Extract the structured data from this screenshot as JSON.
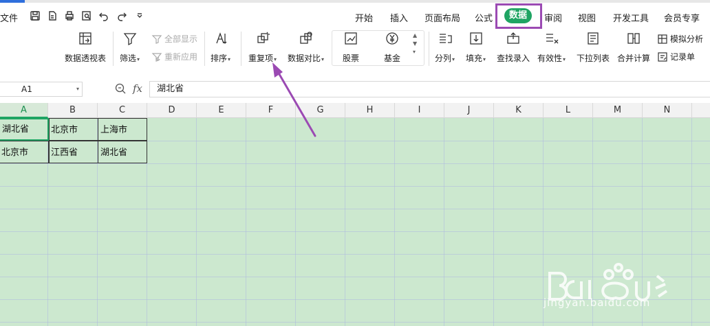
{
  "menu": {
    "file": "文件",
    "tabs": [
      "开始",
      "插入",
      "页面布局",
      "公式",
      "审阅",
      "视图",
      "开发工具",
      "会员专享"
    ],
    "active_tab": "数据"
  },
  "ribbon": {
    "pivot": "数据透视表",
    "filter": "筛选",
    "show_all": "全部显示",
    "reapply": "重新应用",
    "sort": "排序",
    "duplicates": "重复项",
    "compare": "数据对比",
    "stock": "股票",
    "fund": "基金",
    "split": "分列",
    "fill": "填充",
    "lookup": "查找录入",
    "validity": "有效性",
    "dropdown": "下拉列表",
    "consolidate": "合并计算",
    "simulate": "模拟分析",
    "record": "记录单"
  },
  "formula_bar": {
    "name_box": "A1",
    "fx": "fx",
    "value": "湖北省"
  },
  "columns": [
    "A",
    "B",
    "C",
    "D",
    "E",
    "F",
    "G",
    "H",
    "I",
    "J",
    "K",
    "L",
    "M",
    "N"
  ],
  "cells": {
    "A1": "湖北省",
    "B1": "北京市",
    "C1": "上海市",
    "A2": "北京市",
    "B2": "江西省",
    "C2": "湖北省"
  },
  "watermark": "jingyan.baidu.com",
  "colors": {
    "accent": "#1fa463",
    "highlight": "#9b4ab3",
    "sheet_bg": "#cce8cf"
  }
}
